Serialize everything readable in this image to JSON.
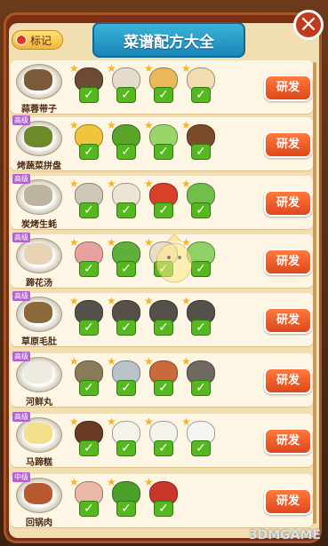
{
  "header": {
    "title": "菜谱配方大全",
    "mark_label": "标记",
    "close_glyph": "×"
  },
  "rows": [
    {
      "dish": "蒜蓉带子",
      "badge": "",
      "food_color": "#7a5a3a",
      "button": "研发",
      "ingredients": [
        {
          "icon": "mushroom-icon",
          "color": "#6d4a34"
        },
        {
          "icon": "garlic-icon",
          "color": "#e6dccd"
        },
        {
          "icon": "scallop-icon",
          "color": "#e9b85a"
        },
        {
          "icon": "squid-icon",
          "color": "#f2ddb0"
        }
      ]
    },
    {
      "dish": "烤蔬菜拼盘",
      "badge": "高级",
      "food_color": "#6c8a2a",
      "button": "研发",
      "ingredients": [
        {
          "icon": "corn-icon",
          "color": "#f2c43a"
        },
        {
          "icon": "pepper-icon",
          "color": "#5aa42a"
        },
        {
          "icon": "bokchoy-icon",
          "color": "#9ad56a"
        },
        {
          "icon": "mushroom-icon",
          "color": "#7a4a2a"
        }
      ]
    },
    {
      "dish": "炭烤生蚝",
      "badge": "高级",
      "food_color": "#bcb3a0",
      "button": "研发",
      "ingredients": [
        {
          "icon": "oyster-icon",
          "color": "#cfc7b8"
        },
        {
          "icon": "garlic-icon",
          "color": "#eee4d6"
        },
        {
          "icon": "chili-icon",
          "color": "#d8402a"
        },
        {
          "icon": "leek-icon",
          "color": "#6fbf4a"
        }
      ]
    },
    {
      "dish": "蹄花汤",
      "badge": "高级",
      "food_color": "#e9d3b5",
      "button": "研发",
      "ingredients": [
        {
          "icon": "meat-icon",
          "color": "#e7a2a0"
        },
        {
          "icon": "peas-icon",
          "color": "#5fb03a"
        },
        {
          "icon": "bone-icon",
          "color": "#eadfc4"
        },
        {
          "icon": "bokchoy-icon",
          "color": "#8fd067"
        }
      ]
    },
    {
      "dish": "草原毛肚",
      "badge": "高级",
      "food_color": "#8a6a3a",
      "button": "研发",
      "ingredients": [
        {
          "icon": "tripe-icon",
          "color": "#55504a"
        },
        {
          "icon": "tripe-icon",
          "color": "#55504a"
        },
        {
          "icon": "tripe-icon",
          "color": "#55504a"
        },
        {
          "icon": "tripe-icon",
          "color": "#55504a"
        }
      ]
    },
    {
      "dish": "河鲜丸",
      "badge": "高级",
      "food_color": "#efeadf",
      "button": "研发",
      "ingredients": [
        {
          "icon": "fish-icon",
          "color": "#8c7b5a"
        },
        {
          "icon": "fish-icon",
          "color": "#b9c2c8"
        },
        {
          "icon": "shrimp-icon",
          "color": "#c86a3a"
        },
        {
          "icon": "fish-icon",
          "color": "#6e6a60"
        }
      ]
    },
    {
      "dish": "马蹄糕",
      "badge": "高级",
      "food_color": "#f2e08a",
      "button": "研发",
      "ingredients": [
        {
          "icon": "chestnut-icon",
          "color": "#6a3a24"
        },
        {
          "icon": "flour-icon",
          "color": "#f5f2ea"
        },
        {
          "icon": "flour-icon",
          "color": "#f5f2ea"
        },
        {
          "icon": "sugar-icon",
          "color": "#f5f5f2"
        }
      ]
    },
    {
      "dish": "回锅肉",
      "badge": "中级",
      "food_color": "#b75a32",
      "button": "研发",
      "ingredients": [
        {
          "icon": "pork-icon",
          "color": "#e9b8a6"
        },
        {
          "icon": "pepper-icon",
          "color": "#4aa02a"
        },
        {
          "icon": "chili-sauce-icon",
          "color": "#c8362a"
        }
      ]
    }
  ],
  "watermark": "3DMGAME"
}
